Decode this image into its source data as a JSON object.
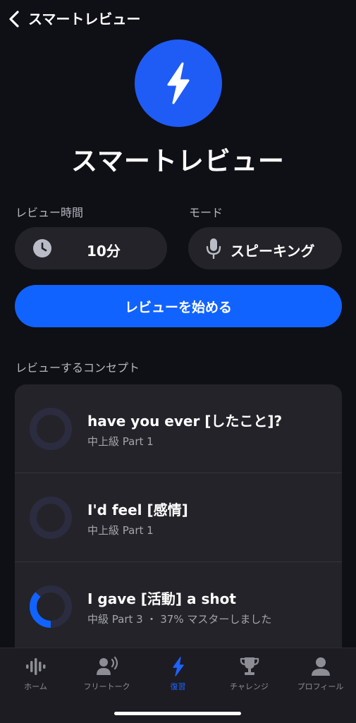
{
  "header": {
    "title": "スマートレビュー",
    "back_icon": "chevron-left-icon"
  },
  "hero": {
    "icon": "bolt-icon",
    "title": "スマートレビュー",
    "color": "#1f5cf5"
  },
  "settings": {
    "time": {
      "label": "レビュー時間",
      "value": "10分",
      "icon": "clock-icon"
    },
    "mode": {
      "label": "モード",
      "value": "スピーキング",
      "icon": "microphone-icon"
    }
  },
  "start_button": {
    "label": "レビューを始める",
    "color": "#1163ff"
  },
  "concepts": {
    "heading": "レビューするコンセプト",
    "items": [
      {
        "title": "have you ever [したこと]?",
        "subtitle": "中上級 Part 1",
        "progress": 0
      },
      {
        "title": "I'd feel [感情]",
        "subtitle": "中上級 Part 1",
        "progress": 0
      },
      {
        "title": "I gave [活動] a shot",
        "subtitle": "中級 Part 3 ・ 37% マスターしました",
        "progress": 0.37
      }
    ]
  },
  "tabbar": {
    "items": [
      {
        "label": "ホーム",
        "icon": "waveform-icon",
        "active": false
      },
      {
        "label": "フリートーク",
        "icon": "speaking-person-icon",
        "active": false
      },
      {
        "label": "復習",
        "icon": "bolt-icon",
        "active": true
      },
      {
        "label": "チャレンジ",
        "icon": "trophy-icon",
        "active": false
      },
      {
        "label": "プロフィール",
        "icon": "person-icon",
        "active": false
      }
    ],
    "active_color": "#1f63ff"
  }
}
